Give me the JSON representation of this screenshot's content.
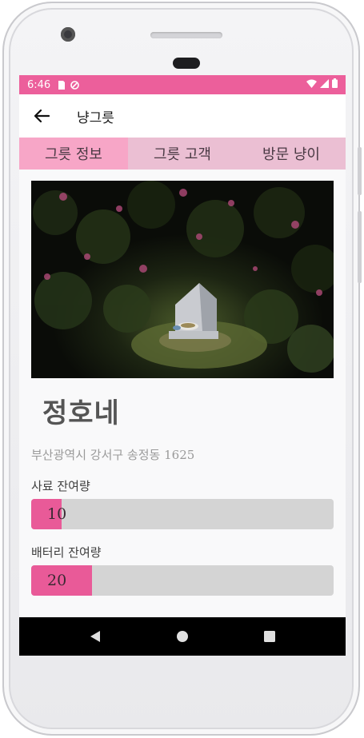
{
  "status_bar": {
    "time": "6:46",
    "bg_color": "#ec5f9b"
  },
  "app_bar": {
    "title": "냥그릇",
    "back_icon": "arrow-left-icon"
  },
  "tabs": [
    {
      "label": "그릇 정보",
      "active": true
    },
    {
      "label": "그릇 고객",
      "active": false
    },
    {
      "label": "방문 냥이",
      "active": false
    }
  ],
  "shop": {
    "name": "정호네",
    "address": "부산광역시 강서구 송정동 1625"
  },
  "food_level": {
    "label": "사료 잔여량",
    "value": "10",
    "percent": 10
  },
  "battery_level": {
    "label": "배터리 잔여량",
    "value": "20",
    "percent": 20
  },
  "colors": {
    "accent": "#e95a98",
    "tab_bg": "#ebbfd3",
    "tab_active": "#f7a6c7"
  }
}
